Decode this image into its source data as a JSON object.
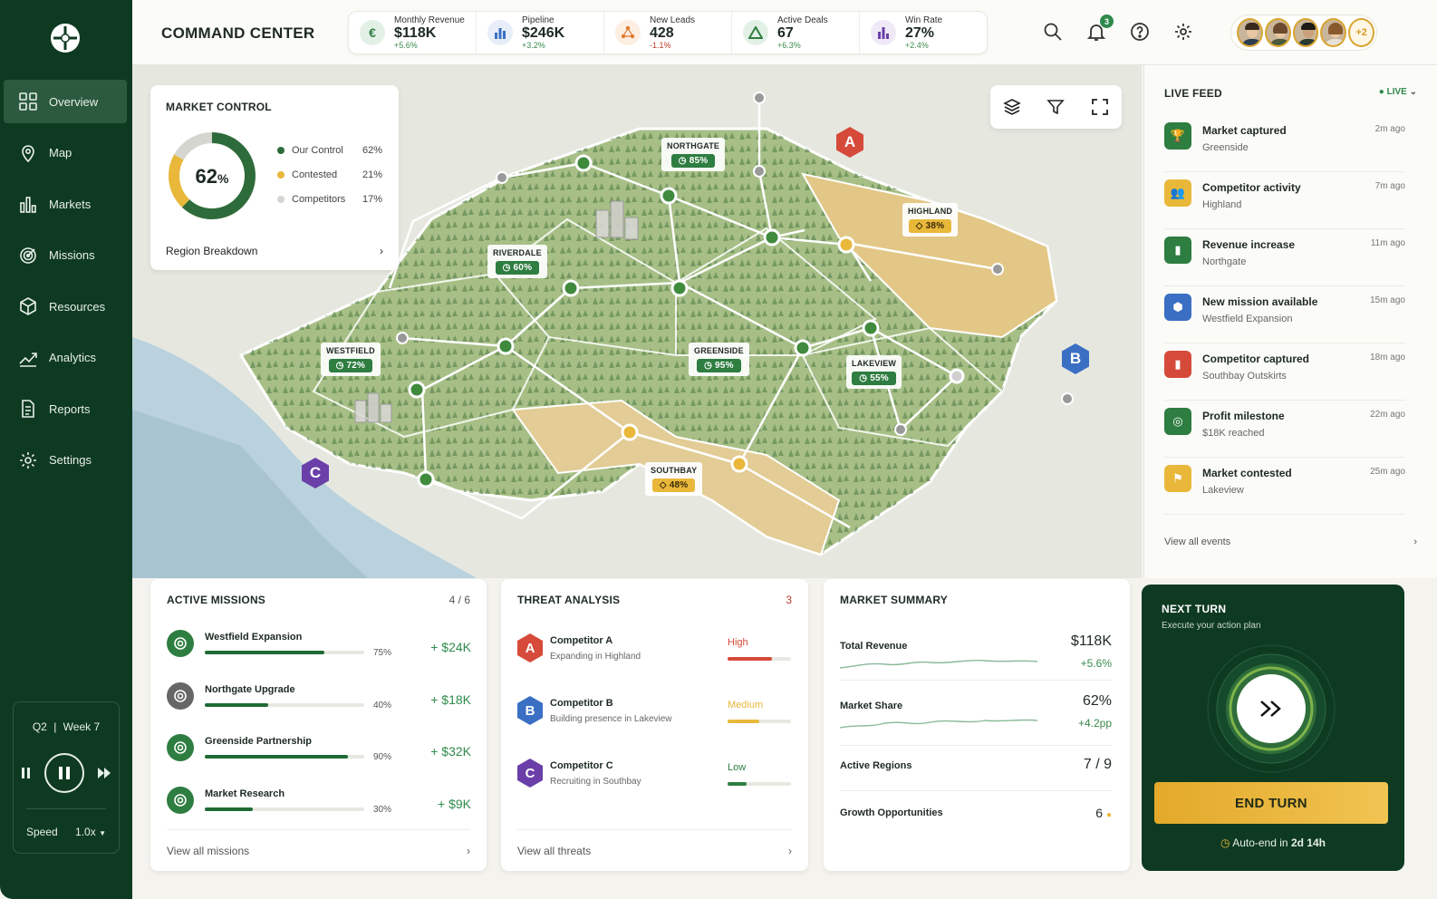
{
  "app": {
    "title": "COMMAND CENTER"
  },
  "colors": {
    "primary": "#0f3a22",
    "accent_green": "#2e7d41",
    "accent_gold": "#e9b83a",
    "danger": "#c0392b"
  },
  "kpis": [
    {
      "label": "Monthly Revenue",
      "value": "$118K",
      "delta": "+5.6%",
      "icon": "euro-icon",
      "trend": "up"
    },
    {
      "label": "Pipeline",
      "value": "$246K",
      "delta": "+3.2%",
      "icon": "bar-chart-icon",
      "trend": "up"
    },
    {
      "label": "New Leads",
      "value": "428",
      "delta": "-1.1%",
      "icon": "nodes-icon",
      "trend": "down"
    },
    {
      "label": "Active Deals",
      "value": "67",
      "delta": "+6.3%",
      "icon": "triangle-icon",
      "trend": "up"
    },
    {
      "label": "Win Rate",
      "value": "27%",
      "delta": "+2.4%",
      "icon": "bar-chart-icon",
      "trend": "up"
    }
  ],
  "notifications": {
    "count": "3"
  },
  "team": {
    "more": "+2"
  },
  "sidebar": {
    "items": [
      {
        "label": "Overview",
        "icon": "grid-icon"
      },
      {
        "label": "Map",
        "icon": "map-pin-icon"
      },
      {
        "label": "Markets",
        "icon": "bar-chart-icon"
      },
      {
        "label": "Missions",
        "icon": "target-icon"
      },
      {
        "label": "Resources",
        "icon": "cube-icon"
      },
      {
        "label": "Analytics",
        "icon": "trend-icon"
      },
      {
        "label": "Reports",
        "icon": "document-icon"
      },
      {
        "label": "Settings",
        "icon": "gear-icon"
      }
    ],
    "playback": {
      "quarter": "Q2",
      "separator": "|",
      "week": "Week 7",
      "speed_label": "Speed",
      "speed_value": "1.0x"
    }
  },
  "market_control": {
    "title": "MARKET CONTROL",
    "center_value": "62",
    "center_unit": "%",
    "segments": [
      {
        "label": "Our Control",
        "value": "62%",
        "pct": 62,
        "color": "#2e6b3a"
      },
      {
        "label": "Contested",
        "value": "21%",
        "pct": 21,
        "color": "#e9b83a"
      },
      {
        "label": "Competitors",
        "value": "17%",
        "pct": 17,
        "color": "#d6d6d0"
      }
    ],
    "footer": "Region Breakdown"
  },
  "regions": [
    {
      "name": "NORTHGATE",
      "value": "85%",
      "status": "control"
    },
    {
      "name": "HIGHLAND",
      "value": "38%",
      "status": "contested"
    },
    {
      "name": "RIVERDALE",
      "value": "60%",
      "status": "control"
    },
    {
      "name": "WESTFIELD",
      "value": "72%",
      "status": "control"
    },
    {
      "name": "GREENSIDE",
      "value": "95%",
      "status": "control"
    },
    {
      "name": "LAKEVIEW",
      "value": "55%",
      "status": "control"
    },
    {
      "name": "SOUTHBAY",
      "value": "48%",
      "status": "contested"
    }
  ],
  "map_markers": [
    {
      "letter": "A",
      "color": "#d64a3a"
    },
    {
      "letter": "B",
      "color": "#3a6fc4"
    },
    {
      "letter": "C",
      "color": "#6a3fa8"
    }
  ],
  "feed": {
    "title": "LIVE FEED",
    "status": "LIVE",
    "items": [
      {
        "title": "Market captured",
        "sub": "Greenside",
        "time": "2m ago",
        "icon": "trophy-icon",
        "color": "#2e7d41"
      },
      {
        "title": "Competitor activity",
        "sub": "Highland",
        "time": "7m ago",
        "icon": "users-icon",
        "color": "#e9b83a"
      },
      {
        "title": "Revenue increase",
        "sub": "Northgate",
        "time": "11m ago",
        "icon": "bar-chart-icon",
        "color": "#2e7d41"
      },
      {
        "title": "New mission available",
        "sub": "Westfield Expansion",
        "time": "15m ago",
        "icon": "cube-icon",
        "color": "#3a6fc4"
      },
      {
        "title": "Competitor captured",
        "sub": "Southbay Outskirts",
        "time": "18m ago",
        "icon": "bar-chart-icon",
        "color": "#d64a3a"
      },
      {
        "title": "Profit milestone",
        "sub": "$18K reached",
        "time": "22m ago",
        "icon": "target-icon",
        "color": "#2e7d41"
      },
      {
        "title": "Market contested",
        "sub": "Lakeview",
        "time": "25m ago",
        "icon": "flag-icon",
        "color": "#e9b83a"
      }
    ],
    "view_all": "View all events"
  },
  "missions": {
    "title": "ACTIVE MISSIONS",
    "count": "4 / 6",
    "items": [
      {
        "name": "Westfield Expansion",
        "pct": "75%",
        "progress": 0.75,
        "value": "+ $24K",
        "color": "#2e7d41"
      },
      {
        "name": "Northgate Upgrade",
        "pct": "40%",
        "progress": 0.4,
        "value": "+ $18K",
        "color": "#666666"
      },
      {
        "name": "Greenside Partnership",
        "pct": "90%",
        "progress": 0.9,
        "value": "+ $32K",
        "color": "#2e7d41"
      },
      {
        "name": "Market Research",
        "pct": "30%",
        "progress": 0.3,
        "value": "+ $9K",
        "color": "#2e7d41"
      }
    ],
    "view_all": "View all missions"
  },
  "threats": {
    "title": "THREAT ANALYSIS",
    "count": "3",
    "items": [
      {
        "letter": "A",
        "name": "Competitor A",
        "sub": "Expanding in Highland",
        "level": "High",
        "level_value": 0.7,
        "color": "#d64a3a"
      },
      {
        "letter": "B",
        "name": "Competitor B",
        "sub": "Building presence in Lakeview",
        "level": "Medium",
        "level_value": 0.5,
        "color": "#3a6fc4",
        "level_color": "#e9b83a"
      },
      {
        "letter": "C",
        "name": "Competitor C",
        "sub": "Recruiting in Southbay",
        "level": "Low",
        "level_value": 0.3,
        "color": "#6a3fa8",
        "level_color": "#2e7d41"
      }
    ],
    "view_all": "View all threats"
  },
  "summary": {
    "title": "MARKET SUMMARY",
    "total_revenue": {
      "label": "Total Revenue",
      "value": "$118K",
      "delta": "+5.6%"
    },
    "market_share": {
      "label": "Market Share",
      "value": "62%",
      "delta": "+4.2pp"
    },
    "active_regions": {
      "label": "Active Regions",
      "value": "7 / 9"
    },
    "growth": {
      "label": "Growth Opportunities",
      "value": "6"
    }
  },
  "next_turn": {
    "title": "NEXT TURN",
    "subtitle": "Execute your action plan",
    "button": "END TURN",
    "auto_label": "Auto-end in",
    "auto_value": "2d 14h"
  }
}
